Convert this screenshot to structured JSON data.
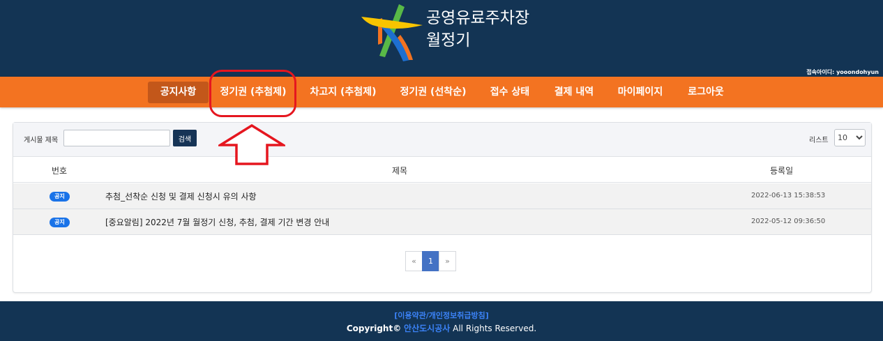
{
  "header": {
    "logo_line1": "공영유료주차장",
    "logo_line2": "월정기",
    "login_info": "접속아이디: yooondohyun"
  },
  "nav": {
    "items": [
      {
        "label": "공지사항",
        "active": true
      },
      {
        "label": "정기권 (추첨제)",
        "active": false
      },
      {
        "label": "차고지 (추첨제)",
        "active": false
      },
      {
        "label": "정기권 (선착순)",
        "active": false
      },
      {
        "label": "접수 상태",
        "active": false
      },
      {
        "label": "결제 내역",
        "active": false
      },
      {
        "label": "마이페이지",
        "active": false
      },
      {
        "label": "로그아웃",
        "active": false
      }
    ]
  },
  "search": {
    "label": "게시물 제목",
    "value": "",
    "button": "검색"
  },
  "list_size": {
    "label": "리스트",
    "selected": "10"
  },
  "table": {
    "headers": [
      "번호",
      "제목",
      "등록일"
    ],
    "rows": [
      {
        "badge": "공지",
        "title": "추첨_선착순 신청 및 결제 신청시 유의 사항",
        "date": "2022-06-13 15:38:53"
      },
      {
        "badge": "공지",
        "title": "[중요알림] 2022년 7월 월정기 신청, 추첨, 결제 기간 변경 안내",
        "date": "2022-05-12 09:36:50"
      }
    ]
  },
  "pagination": {
    "prev": "«",
    "current": "1",
    "next": "»"
  },
  "footer": {
    "link": "[이용약관/개인정보취급방침]",
    "copyright_prefix": "Copyright©",
    "org": "안산도시공사",
    "copyright_suffix": "All Rights Reserved."
  },
  "colors": {
    "header_bg": "#133454",
    "nav_bg": "#f37321",
    "nav_active": "#c3571a",
    "badge": "#1a73e8",
    "annotation": "#e5161f"
  }
}
